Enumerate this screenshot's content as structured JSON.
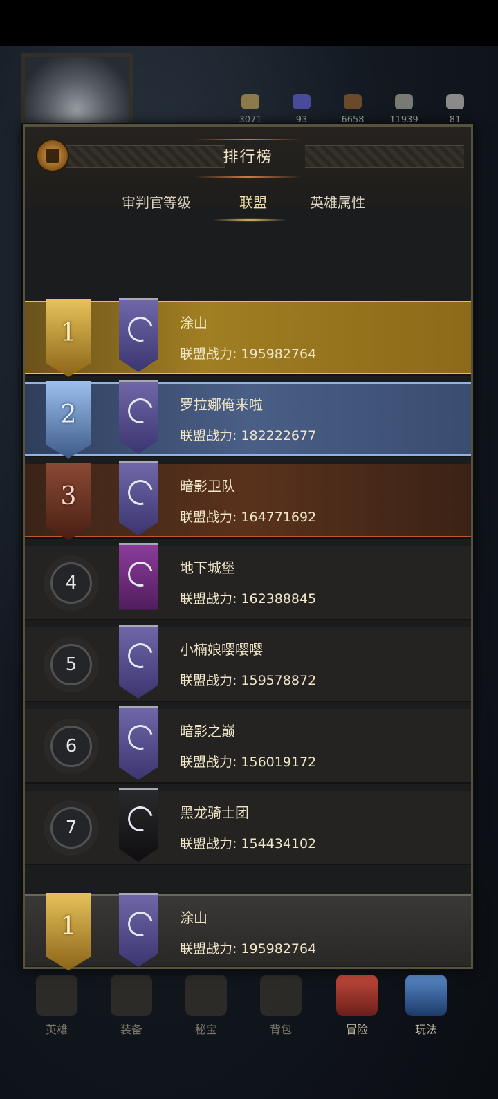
{
  "background": {
    "resources": [
      {
        "icon": "gold-coin-icon",
        "value": "3071"
      },
      {
        "icon": "crystal-icon",
        "value": "93"
      },
      {
        "icon": "wood-icon",
        "value": "6658"
      },
      {
        "icon": "stone-icon",
        "value": "11939"
      },
      {
        "icon": "iron-icon",
        "value": "81"
      }
    ],
    "bottom_nav": [
      {
        "icon": "hero-icon",
        "label": "英雄"
      },
      {
        "icon": "equip-icon",
        "label": "装备"
      },
      {
        "icon": "treasure-icon",
        "label": "秘宝"
      },
      {
        "icon": "bag-icon",
        "label": "背包"
      },
      {
        "icon": "adventure-icon",
        "label": "冒险"
      },
      {
        "icon": "play-icon",
        "label": "玩法"
      }
    ]
  },
  "panel": {
    "title": "排行榜",
    "tabs": [
      {
        "label": "审判官等级"
      },
      {
        "label": "联盟"
      },
      {
        "label": "英雄属性"
      }
    ],
    "power_label": "联盟战力:",
    "rows": [
      {
        "rank": "1",
        "name": "涂山",
        "power": "195982764"
      },
      {
        "rank": "2",
        "name": "罗拉娜俺来啦",
        "power": "182222677"
      },
      {
        "rank": "3",
        "name": "暗影卫队",
        "power": "164771692"
      },
      {
        "rank": "4",
        "name": "地下城堡",
        "power": "162388845"
      },
      {
        "rank": "5",
        "name": "小楠娘嘤嘤嘤",
        "power": "159578872"
      },
      {
        "rank": "6",
        "name": "暗影之巅",
        "power": "156019172"
      },
      {
        "rank": "7",
        "name": "黑龙骑士团",
        "power": "154434102"
      }
    ],
    "my_alliance": {
      "rank": "1",
      "name": "涂山",
      "power": "195982764"
    }
  },
  "colors": {
    "gold": "#a07e22",
    "silver": "#4a5f86",
    "bronze": "#5a321c",
    "text": "#f1e6c8"
  }
}
